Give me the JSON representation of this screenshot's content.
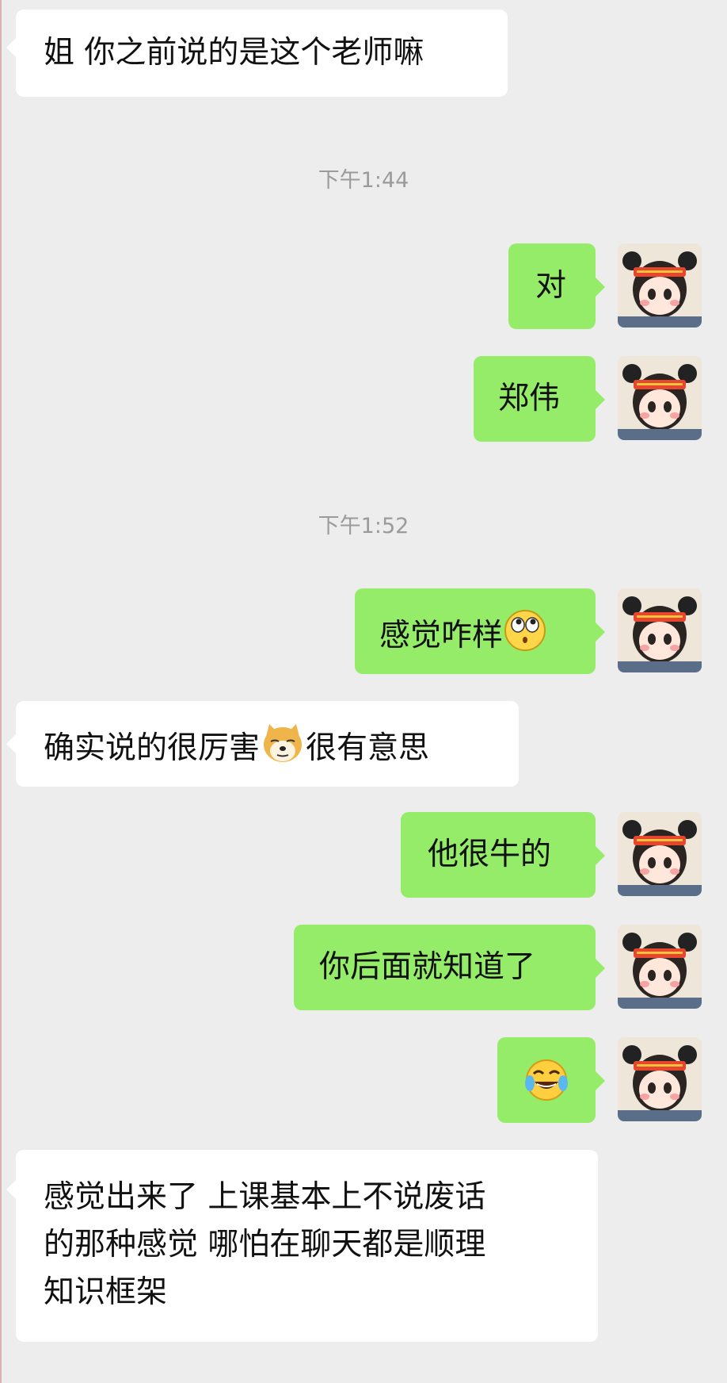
{
  "chat": {
    "messages": [
      {
        "side": "in",
        "text": "姐 你之前说的是这个老师嘛"
      },
      {
        "timestamp": "下午1:44"
      },
      {
        "side": "out",
        "text": "对"
      },
      {
        "side": "out",
        "text": "郑伟"
      },
      {
        "timestamp": "下午1:52"
      },
      {
        "side": "out",
        "text": "感觉咋样",
        "emoji": "rolling-eyes-emoji"
      },
      {
        "side": "in",
        "text_before": "确实说的很厉害",
        "emoji": "doge-emoji",
        "text_after": "很有意思"
      },
      {
        "side": "out",
        "text": "他很牛的"
      },
      {
        "side": "out",
        "text": "你后面就知道了"
      },
      {
        "side": "out",
        "emoji": "tears-of-joy-emoji"
      },
      {
        "side": "in",
        "lines": [
          "感觉出来了 上课基本上不说废话",
          "的那种感觉  哪怕在聊天都是顺理",
          "知识框架"
        ]
      }
    ]
  },
  "colors": {
    "background": "#ededed",
    "incoming_bubble": "#ffffff",
    "outgoing_bubble": "#95ec69",
    "timestamp": "#9b9b9b"
  },
  "avatar_icon": "cartoon-avatar-icon"
}
